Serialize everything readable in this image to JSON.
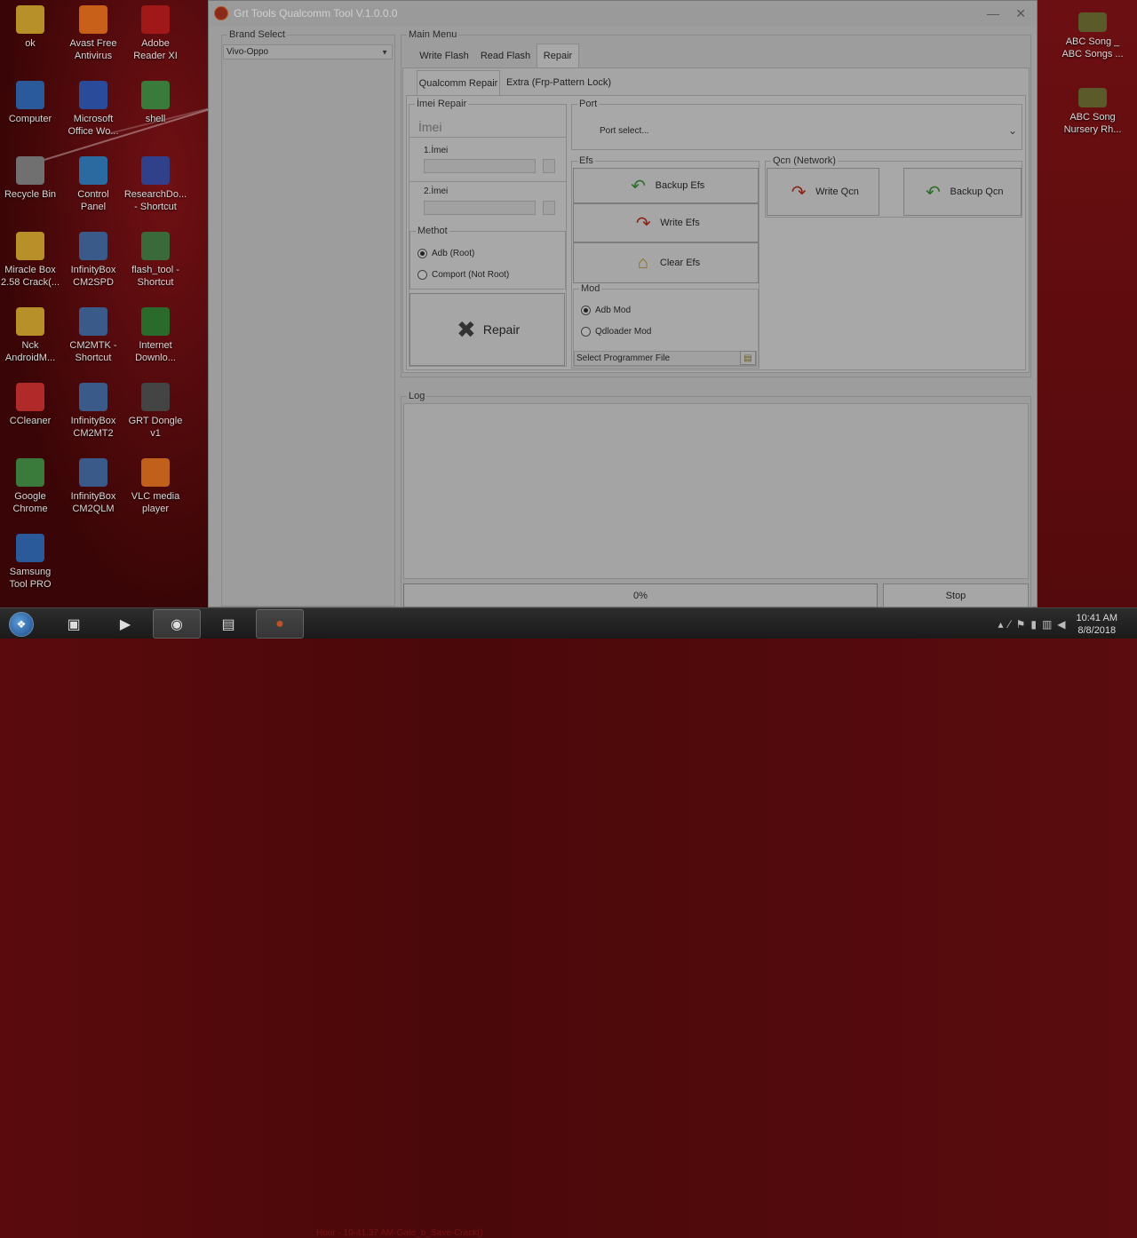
{
  "desktop": {
    "left_icons": [
      {
        "label": "ok",
        "icon": "folder-icon"
      },
      {
        "label": "Avast Free\nAntivirus",
        "icon": "avast-icon"
      },
      {
        "label": "Adobe\nReader XI",
        "icon": "pdf-icon"
      },
      {
        "label": "Computer",
        "icon": "computer-icon"
      },
      {
        "label": "Microsoft\nOffice Wo...",
        "icon": "word-icon"
      },
      {
        "label": "shell",
        "icon": "shell-icon"
      },
      {
        "label": "Recycle Bin",
        "icon": "recycle-bin-icon"
      },
      {
        "label": "Control\nPanel",
        "icon": "control-panel-icon"
      },
      {
        "label": "ResearchDo...\n- Shortcut",
        "icon": "shortcut-icon"
      },
      {
        "label": "Miracle Box\n2.58 Crack(...",
        "icon": "folder-icon"
      },
      {
        "label": "InfinityBox\nCM2SPD",
        "icon": "infinitybox-icon"
      },
      {
        "label": "flash_tool -\nShortcut",
        "icon": "flash-tool-icon"
      },
      {
        "label": "Nck\nAndroidM...",
        "icon": "folder-icon"
      },
      {
        "label": "CM2MTK -\nShortcut",
        "icon": "infinitybox-icon"
      },
      {
        "label": "Internet\nDownlo...",
        "icon": "internet-download-icon"
      },
      {
        "label": "CCleaner",
        "icon": "ccleaner-icon"
      },
      {
        "label": "InfinityBox\nCM2MT2",
        "icon": "infinitybox-icon"
      },
      {
        "label": "GRT Dongle\nv1",
        "icon": "grt-dongle-icon"
      },
      {
        "label": "Google\nChrome",
        "icon": "chrome-icon"
      },
      {
        "label": "InfinityBox\nCM2QLM",
        "icon": "infinitybox-icon"
      },
      {
        "label": "VLC media\nplayer",
        "icon": "vlc-icon"
      },
      {
        "label": "Samsung\nTool PRO",
        "icon": "samsung-tool-icon"
      }
    ],
    "right_icons": [
      {
        "label": "ABC Song _\nABC Songs ...",
        "icon": "video-file-icon"
      },
      {
        "label": "ABC Song\nNursery Rh...",
        "icon": "video-file-icon"
      }
    ]
  },
  "window": {
    "title": "Grt Tools Qualcomm Tool V.1.0.0.0",
    "minimize": "—",
    "close": "✕"
  },
  "brand": {
    "legend": "Brand Select",
    "selected": "Vivo-Oppo"
  },
  "main_menu": {
    "legend": "Main Menu",
    "tabs": [
      "Write Flash",
      "Read Flash",
      "Repair"
    ],
    "active_tab": "Repair",
    "subtabs": [
      "Qualcomm Repair",
      "Extra (Frp-Pattern Lock)"
    ],
    "active_subtab": "Qualcomm Repair"
  },
  "imei_repair": {
    "legend": "İmei Repair",
    "header": "İmei",
    "imei1_label": "1.İmei",
    "imei2_label": "2.İmei",
    "imei1_value": "",
    "imei2_value": ""
  },
  "method": {
    "legend": "Methot",
    "options": [
      "Adb (Root)",
      "Comport (Not Root)"
    ],
    "selected": "Adb (Root)"
  },
  "repair_button": "Repair",
  "port": {
    "legend": "Port",
    "selected": "Port select..."
  },
  "efs": {
    "legend": "Efs",
    "backup": "Backup Efs",
    "write": "Write Efs",
    "clear": "Clear Efs"
  },
  "mod": {
    "legend": "Mod",
    "options": [
      "Adb Mod",
      "Qdloader Mod"
    ],
    "selected": "Adb Mod",
    "programmer_placeholder": "Select Programmer File"
  },
  "qcn": {
    "legend": "Qcn (Network)",
    "write": "Write Qcn",
    "backup": "Backup Qcn"
  },
  "log": {
    "legend": "Log",
    "progress_text": "0%",
    "progress": 0,
    "stop": "Stop"
  },
  "taskbar": {
    "time": "10:41 AM",
    "date": "8/8/2018",
    "ghost_text": "Hour - 10-41.37 AM-Gate_b_Save-Crack()"
  }
}
